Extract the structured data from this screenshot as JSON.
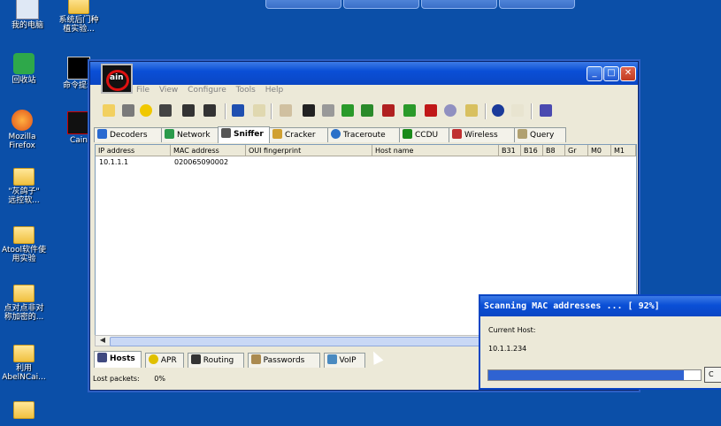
{
  "desktop": {
    "icons": [
      {
        "label": "我的电脑"
      },
      {
        "label": "回收站"
      },
      {
        "label": "Mozilla\nFirefox"
      },
      {
        "label": "\"灰鸽子\"\n远控软..."
      },
      {
        "label": "Atool软件使\n用实验"
      },
      {
        "label": "点对点非对\n称加密的..."
      },
      {
        "label": "利用\nAbelNCai..."
      },
      {
        "label": "系统后门种\n植实验..."
      },
      {
        "label": "命令提示"
      },
      {
        "label": "Cain"
      }
    ]
  },
  "window": {
    "menu": [
      "File",
      "View",
      "Configure",
      "Tools",
      "Help"
    ],
    "title_buttons": {
      "minimize": "_",
      "maximize": "□",
      "close": "✕"
    },
    "tabs": [
      "Decoders",
      "Network",
      "Sniffer",
      "Cracker",
      "Traceroute",
      "CCDU",
      "Wireless",
      "Query"
    ],
    "active_tab": "Sniffer",
    "columns": [
      "IP address",
      "MAC address",
      "OUI fingerprint",
      "Host name",
      "B31",
      "B16",
      "B8",
      "Gr",
      "M0",
      "M1"
    ],
    "rows": [
      {
        "ip": "10.1.1.1",
        "mac": "020065090002",
        "oui": "",
        "host": ""
      }
    ],
    "bottom_tabs": [
      "Hosts",
      "APR",
      "Routing",
      "Passwords",
      "VoIP"
    ],
    "status": {
      "lost_packets_label": "Lost packets:",
      "lost_packets_value": "0%"
    }
  },
  "dialog": {
    "title": "Scanning MAC addresses ... [ 92%]",
    "current_host_label": "Current Host:",
    "current_host": "10.1.1.234",
    "progress": 0.92,
    "button": "C"
  },
  "colors": {
    "desktop": "#0b4fa8",
    "titlebar": "#0a4fd6",
    "progress": "#2f63d2"
  }
}
